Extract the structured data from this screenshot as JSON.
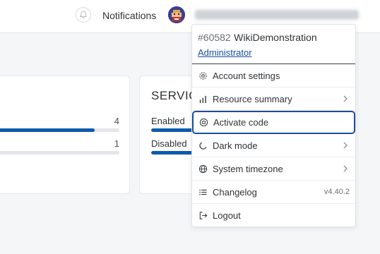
{
  "header": {
    "notifications_label": "Notifications"
  },
  "cards": {
    "left_card": {
      "rows": [
        {
          "count": "4",
          "progress": 0.8
        },
        {
          "count": "1",
          "progress": 0.2
        }
      ]
    },
    "service_card": {
      "title": "SERVICE",
      "rows": [
        {
          "label": "Enabled"
        },
        {
          "label": "Disabled"
        }
      ]
    }
  },
  "account_menu": {
    "account_id": "#60582",
    "account_name": "WikiDemonstration",
    "role": "Administrator",
    "items": [
      {
        "label": "Account settings",
        "icon": "gear-icon"
      },
      {
        "label": "Resource summary",
        "icon": "bar-chart-icon"
      },
      {
        "label": "Activate code",
        "icon": "activate-code-icon"
      },
      {
        "label": "Dark mode",
        "icon": "moon-icon"
      },
      {
        "label": "System timezone",
        "icon": "globe-icon"
      },
      {
        "label": "Changelog",
        "icon": "list-icon",
        "version": "v4.40.2"
      },
      {
        "label": "Logout",
        "icon": "logout-icon"
      }
    ]
  },
  "colors": {
    "accent": "#0d5bab",
    "focus_ring": "#1d4d96",
    "link": "#1a4fa0"
  }
}
